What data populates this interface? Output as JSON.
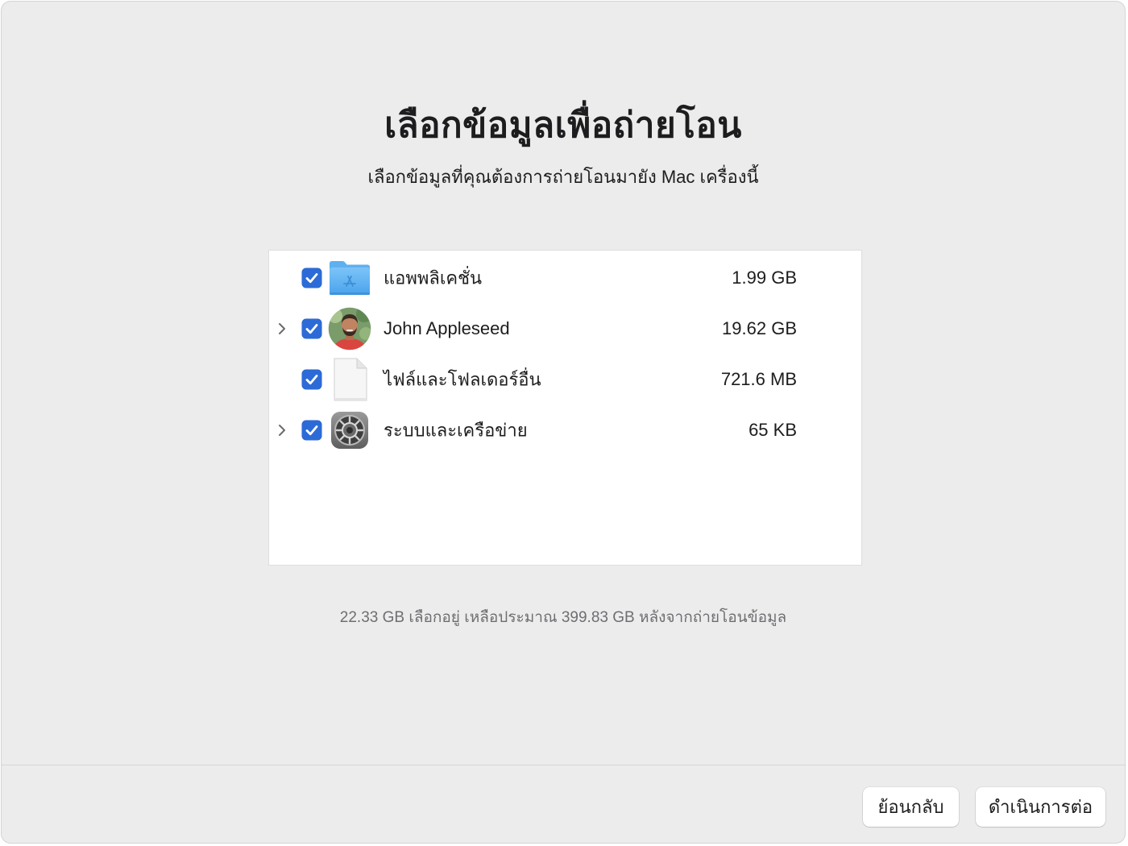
{
  "header": {
    "title": "เลือกข้อมูลเพื่อถ่ายโอน",
    "subtitle": "เลือกข้อมูลที่คุณต้องการถ่ายโอนมายัง Mac เครื่องนี้"
  },
  "items": [
    {
      "label": "แอพพลิเคชั่น",
      "size": "1.99 GB",
      "checked": true,
      "expandable": false,
      "icon": "applications-folder-icon"
    },
    {
      "label": "John Appleseed",
      "size": "19.62 GB",
      "checked": true,
      "expandable": true,
      "icon": "user-avatar-icon"
    },
    {
      "label": "ไฟล์และโฟลเดอร์อื่น",
      "size": "721.6 MB",
      "checked": true,
      "expandable": false,
      "icon": "document-icon"
    },
    {
      "label": "ระบบและเครือข่าย",
      "size": "65 KB",
      "checked": true,
      "expandable": true,
      "icon": "system-settings-gear-icon"
    }
  ],
  "summary": "22.33 GB เลือกอยู่ เหลือประมาณ 399.83 GB หลังจากถ่ายโอนข้อมูล",
  "buttons": {
    "back": "ย้อนกลับ",
    "continue": "ดำเนินการต่อ"
  },
  "colors": {
    "accent": "#2c6bd7",
    "window_bg": "#ececec",
    "list_bg": "#ffffff",
    "text_primary": "#1d1d1f",
    "text_secondary": "#6e6e73"
  }
}
